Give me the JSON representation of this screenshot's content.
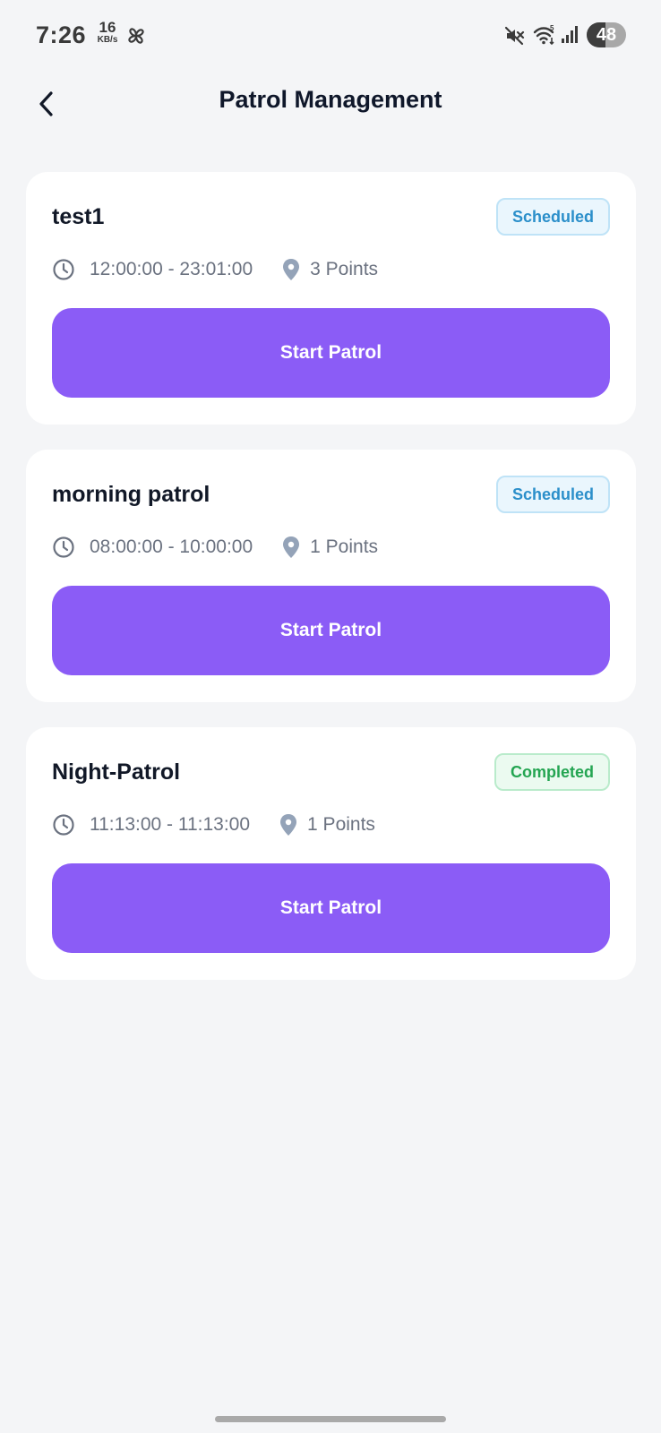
{
  "status_bar": {
    "time": "7:26",
    "net_speed_value": "16",
    "net_speed_unit": "KB/s",
    "battery": "48",
    "battery_level": 0.48,
    "icons": [
      "pinwheel-icon",
      "mute-icon",
      "wifi-icon",
      "signal-icon"
    ]
  },
  "header": {
    "title": "Patrol Management",
    "back_icon": "chevron-left-icon"
  },
  "colors": {
    "background": "#f4f5f7",
    "card": "#ffffff",
    "accent": "#8b5cf6",
    "scheduled": "#2b8fca",
    "completed": "#24a552",
    "meta": "#6b7280"
  },
  "patrols": [
    {
      "name": "test1",
      "status": "Scheduled",
      "time_range": "12:00:00 - 23:01:00",
      "points": "3 Points",
      "button_label": "Start Patrol"
    },
    {
      "name": "morning patrol",
      "status": "Scheduled",
      "time_range": "08:00:00 - 10:00:00",
      "points": "1 Points",
      "button_label": "Start Patrol"
    },
    {
      "name": "Night-Patrol",
      "status": "Completed",
      "time_range": "11:13:00 - 11:13:00",
      "points": "1 Points",
      "button_label": "Start Patrol"
    }
  ]
}
